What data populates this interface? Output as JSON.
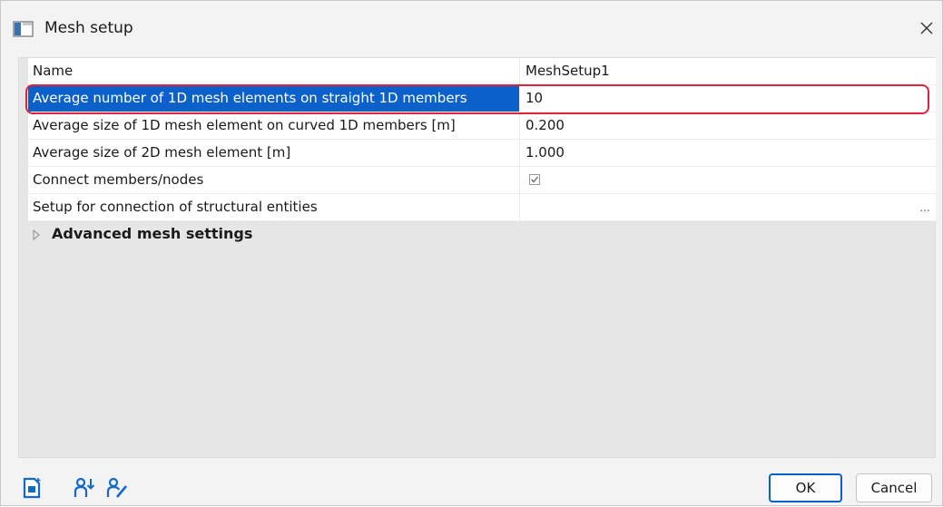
{
  "window": {
    "title": "Mesh setup",
    "close_glyph": "✕"
  },
  "properties": [
    {
      "name": "Name",
      "value": "MeshSetup1"
    },
    {
      "name": "Average number of 1D mesh elements on straight 1D members",
      "value": "10",
      "selected": true
    },
    {
      "name": "Average size of 1D mesh element on curved 1D members [m]",
      "value": "0.200"
    },
    {
      "name": "Average size of 2D mesh element [m]",
      "value": "1.000"
    },
    {
      "name": "Connect members/nodes",
      "value": "",
      "checked": true
    },
    {
      "name": "Setup for connection of structural entities",
      "value": "",
      "ellipsis": "..."
    }
  ],
  "advanced_section": {
    "label": "Advanced mesh settings",
    "expanded": false
  },
  "toolbar_icons": [
    "new-document-icon",
    "user-import-icon",
    "user-edit-icon"
  ],
  "buttons": {
    "ok": "OK",
    "cancel": "Cancel"
  },
  "colors": {
    "selection": "#0b61c9",
    "highlight_outline": "#e0243c",
    "icon_blue": "#1469c7"
  }
}
